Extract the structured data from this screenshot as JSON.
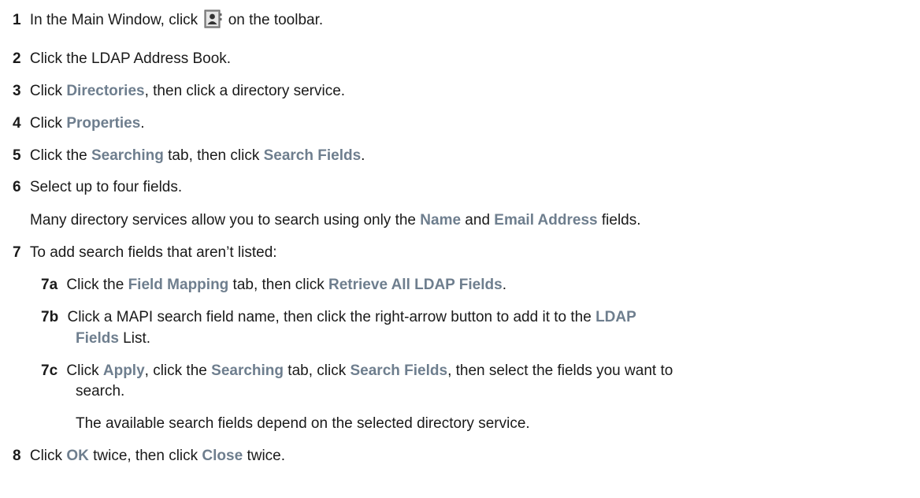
{
  "steps": [
    {
      "num": "1",
      "pre": "In the Main Window, click",
      "post": "on the toolbar.",
      "icon": "address-book-icon"
    },
    {
      "num": "2",
      "text": "Click the LDAP Address Book."
    },
    {
      "num": "3",
      "a": "Click ",
      "b": "Directories",
      "c": ", then click a directory service."
    },
    {
      "num": "4",
      "a": "Click ",
      "b": "Properties",
      "c": "."
    },
    {
      "num": "5",
      "a": "Click the ",
      "b": "Searching",
      "c": " tab, then click ",
      "d": "Search Fields",
      "e": "."
    },
    {
      "num": "6",
      "text": "Select up to four fields."
    },
    {
      "note6": {
        "a": "Many directory services allow you to search using only the ",
        "b": "Name",
        "c": " and ",
        "d": "Email Address",
        "e": " fields."
      }
    },
    {
      "num": "7",
      "text": "To add search fields that aren’t listed:"
    },
    {
      "num": "7a",
      "a": "Click the ",
      "b": "Field Mapping",
      "c": " tab, then click ",
      "d": "Retrieve All LDAP Fields",
      "e": "."
    },
    {
      "num": "7b",
      "a": "Click a MAPI search field name, then click the right-arrow button to add it to the ",
      "b": "LDAP",
      "c": "Fields",
      "d": " List."
    },
    {
      "num": "7c",
      "a": "Click ",
      "b": "Apply",
      "c": ", click the ",
      "d": "Searching",
      "e": " tab, click ",
      "f": "Search Fields",
      "g": ", then select the fields you want to",
      "h": "search."
    },
    {
      "note7c": "The available search fields depend on the selected directory service."
    },
    {
      "num": "8",
      "a": "Click ",
      "b": "OK",
      "c": " twice, then click ",
      "d": "Close",
      "e": " twice."
    }
  ]
}
